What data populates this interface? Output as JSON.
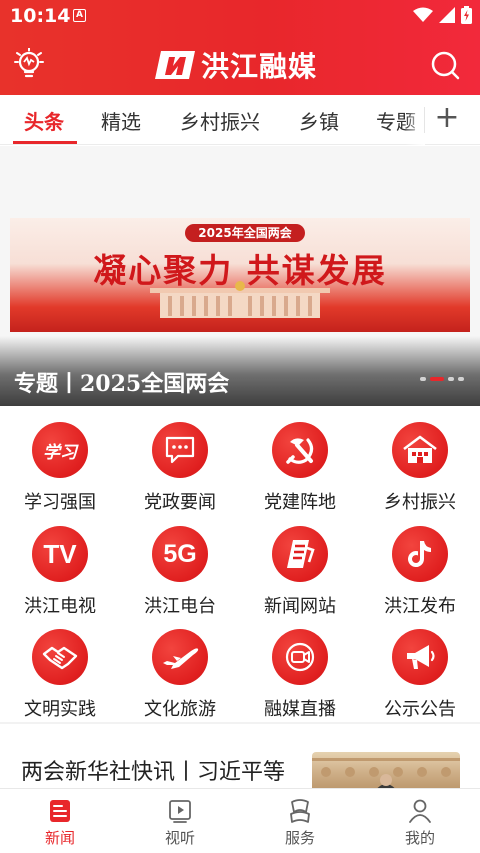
{
  "status_bar": {
    "time": "10:14",
    "notif_letter": "A"
  },
  "app": {
    "title": "洪江融媒"
  },
  "icons": {
    "bulb": "lightbulb-icon",
    "search": "search-icon",
    "wifi": "wifi-icon",
    "signal": "signal-icon",
    "battery": "battery-icon",
    "add": "plus-icon"
  },
  "tabs": [
    {
      "label": "头条",
      "active": true
    },
    {
      "label": "精选",
      "active": false
    },
    {
      "label": "乡村振兴",
      "active": false
    },
    {
      "label": "乡镇",
      "active": false
    },
    {
      "label": "专题",
      "active": false
    }
  ],
  "add_tab_label": "+",
  "banner": {
    "badge": "2025年全国两会",
    "headline": "凝心聚力  共谋发展",
    "caption": "专题丨2025全国两会",
    "slide_count": 4,
    "active_slide": 2
  },
  "grid": [
    {
      "label": "学习强国",
      "icon": "xuexi-icon",
      "glyph": "学习"
    },
    {
      "label": "党政要闻",
      "icon": "chat-bubble-icon"
    },
    {
      "label": "党建阵地",
      "icon": "hammer-sickle-icon"
    },
    {
      "label": "乡村振兴",
      "icon": "house-icon"
    },
    {
      "label": "洪江电视",
      "icon": "tv-icon",
      "glyph": "TV"
    },
    {
      "label": "洪江电台",
      "icon": "5g-radio-icon",
      "glyph": "5G"
    },
    {
      "label": "新闻网站",
      "icon": "website-icon"
    },
    {
      "label": "洪江发布",
      "icon": "tiktok-icon"
    },
    {
      "label": "文明实践",
      "icon": "handshake-icon"
    },
    {
      "label": "文化旅游",
      "icon": "airplane-icon"
    },
    {
      "label": "融媒直播",
      "icon": "video-camera-icon"
    },
    {
      "label": "公示公告",
      "icon": "megaphone-icon"
    }
  ],
  "news": [
    {
      "title": "两会新华社快讯丨习近平等"
    }
  ],
  "bottom_nav": [
    {
      "label": "新闻",
      "icon": "news-icon",
      "active": true
    },
    {
      "label": "视听",
      "icon": "video-play-icon",
      "active": false
    },
    {
      "label": "服务",
      "icon": "service-icon",
      "active": false
    },
    {
      "label": "我的",
      "icon": "profile-icon",
      "active": false
    }
  ],
  "colors": {
    "brand_red": "#e8272b",
    "text": "#222222",
    "muted": "#555555"
  }
}
